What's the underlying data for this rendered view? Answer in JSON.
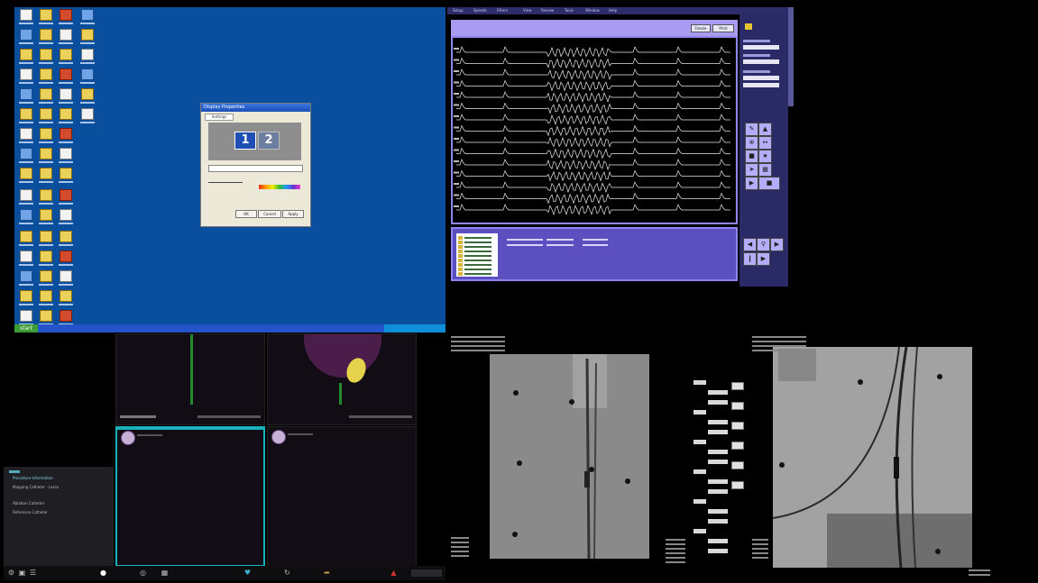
{
  "xp_desktop": {
    "start_label": "start",
    "display_dialog": {
      "title": "Display Properties",
      "tab_label": "Settings",
      "monitor_1": "1",
      "monitor_2": "2",
      "buttons": [
        "OK",
        "Cancel",
        "Apply"
      ]
    }
  },
  "ep_system": {
    "menu_items": [
      "Setup",
      "Speeds",
      "Filters",
      "View",
      "Review",
      "Tools",
      "Window",
      "Help"
    ],
    "control_buttons": [
      "Freeze",
      "Print"
    ],
    "trace_colors": {
      "trace": "#e8e8e8",
      "frame": "#8f85ef",
      "background": "#000000"
    },
    "channel_count": 15
  },
  "mapping": {
    "menu_items": [
      "Procedure Information",
      "Mapping Catheter - Lasso",
      "Ablation Catheter",
      "Reference Catheter"
    ],
    "taskbar_icons": [
      "settings-icon",
      "camera-icon",
      "layers-icon",
      "home-icon",
      "target-icon",
      "grid-icon",
      "heart-icon",
      "refresh-icon",
      "export-icon",
      "alert-icon"
    ]
  },
  "fluoro": {
    "left": {
      "markers": 6
    },
    "right": {
      "markers": 4
    }
  }
}
